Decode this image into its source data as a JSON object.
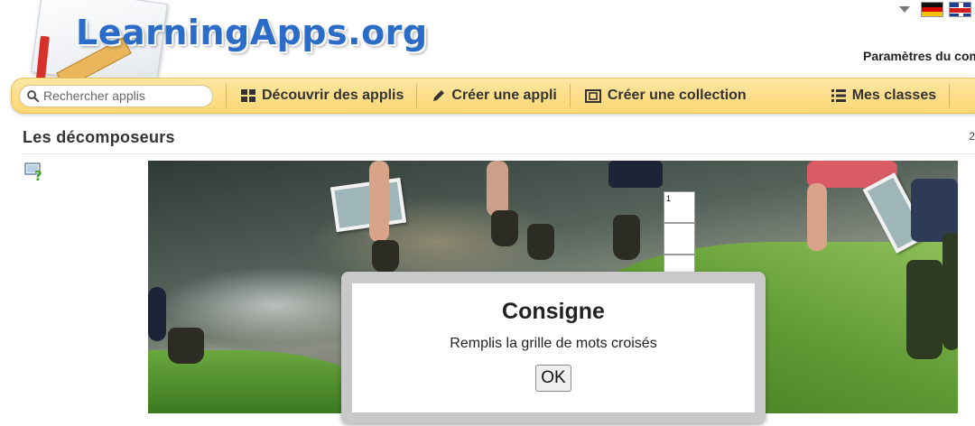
{
  "header": {
    "logo_text": "LearningApps.org",
    "settings_label": "Paramètres du compte",
    "languages": [
      "de",
      "en"
    ]
  },
  "nav": {
    "search_placeholder": "Rechercher applis",
    "items": [
      {
        "label": "Découvrir des applis",
        "icon": "grid-icon"
      },
      {
        "label": "Créer une appli",
        "icon": "pencil-icon"
      },
      {
        "label": "Créer une collection",
        "icon": "collection-icon"
      },
      {
        "label": "Mes classes",
        "icon": "list-icon"
      }
    ]
  },
  "page": {
    "title": "Les décomposeurs",
    "count": "2"
  },
  "app": {
    "grid_first_number": "1",
    "dialog": {
      "title": "Consigne",
      "text": "Remplis la grille de mots croisés",
      "button": "OK"
    }
  },
  "colors": {
    "nav_bg": "#fbd673",
    "logo_blue": "#2b6cc9"
  }
}
